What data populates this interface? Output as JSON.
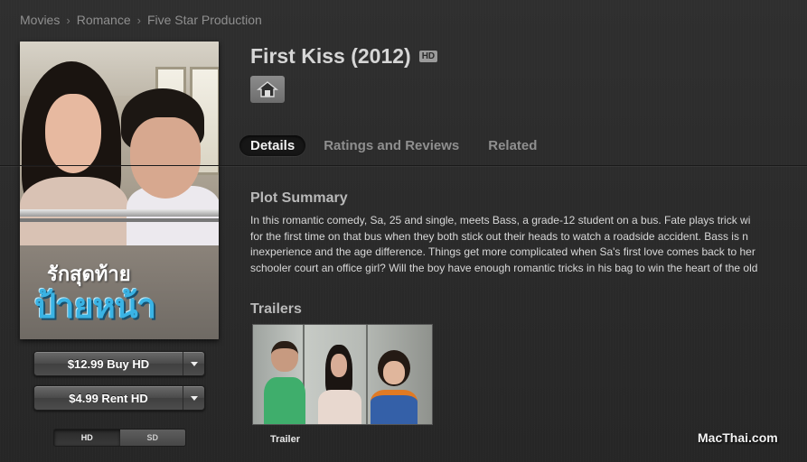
{
  "breadcrumb": [
    "Movies",
    "Romance",
    "Five Star Production"
  ],
  "poster": {
    "thai_line1": "รักสุดท้าย",
    "thai_line2": "ป้ายหน้า"
  },
  "purchase": {
    "buy_label": "$12.99 Buy HD",
    "rent_label": "$4.99 Rent HD",
    "format_options": [
      "HD",
      "SD"
    ],
    "selected_format": "HD"
  },
  "movie": {
    "title": "First Kiss (2012)",
    "badge": "HD"
  },
  "tabs": [
    {
      "label": "Details",
      "active": true
    },
    {
      "label": "Ratings and Reviews",
      "active": false
    },
    {
      "label": "Related",
      "active": false
    }
  ],
  "plot": {
    "heading": "Plot Summary",
    "lines": [
      "In this romantic comedy, Sa, 25 and single, meets Bass, a grade-12 student on a bus. Fate plays trick wi",
      "for the first time on that bus when they both stick out their heads to watch a roadside accident. Bass is n",
      "inexperience and the age difference. Things get more complicated when Sa's first love comes back to her",
      "schooler court an office girl? Will the boy have enough romantic tricks in his bag to win the heart of the old"
    ]
  },
  "trailers": {
    "heading": "Trailers",
    "items": [
      {
        "label": "Trailer"
      }
    ]
  },
  "watermark": "MacThai.com"
}
